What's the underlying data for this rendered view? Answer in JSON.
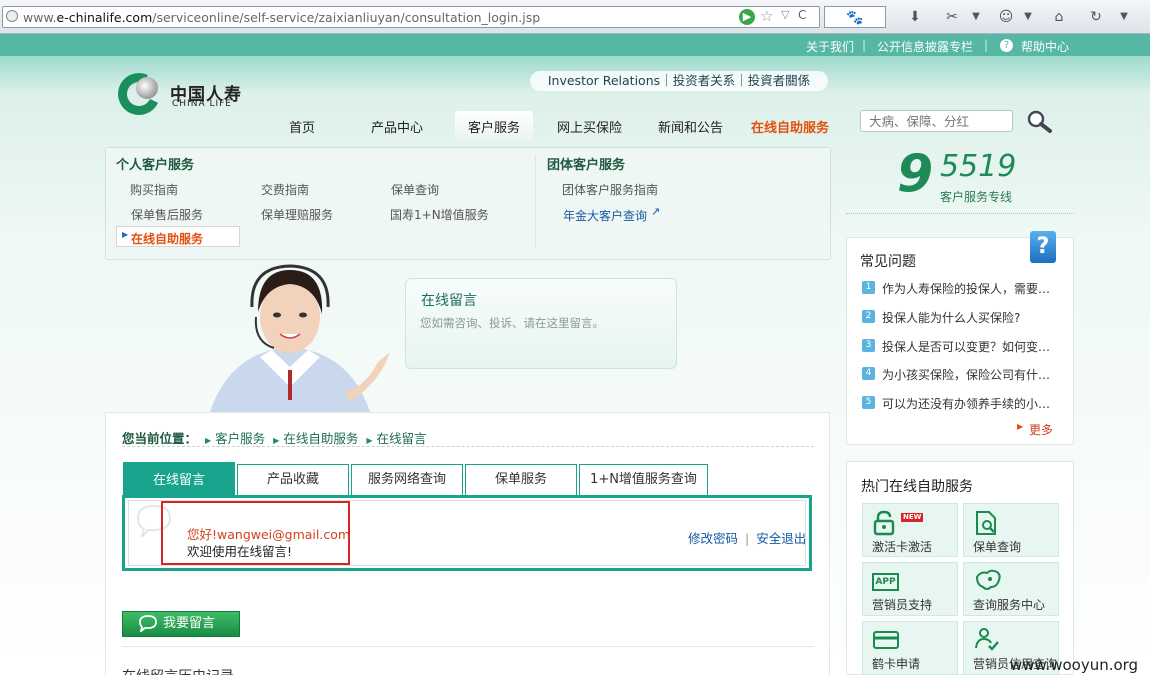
{
  "browser": {
    "url_prefix": "www.",
    "url_host": "e-chinalife.com",
    "url_path": "/serviceonline/self-service/zaixianliuyan/consultation_login.jsp"
  },
  "toplinks": [
    "关于我们",
    "公开信息披露专栏",
    "帮助中心"
  ],
  "logo": {
    "cn": "中国人寿",
    "en": "CHINA LIFE"
  },
  "investor": "Investor Relations｜投资者关系｜投資者關係",
  "nav": [
    "首页",
    "产品中心",
    "客户服务",
    "网上买保险",
    "新闻和公告",
    "在线自助服务"
  ],
  "search": {
    "placeholder": "大病、保障、分红"
  },
  "subnav": {
    "personal_title": "个人客户服务",
    "personal_items": [
      "购买指南",
      "交费指南",
      "保单查询",
      "保单售后服务",
      "保单理赔服务",
      "国寿1+N增值服务",
      "在线自助服务"
    ],
    "group_title": "团体客户服务",
    "group_items": [
      "团体客户服务指南",
      "年金大客户查询"
    ]
  },
  "hotline": {
    "number": "9",
    "rest": "5519",
    "label": "客户服务专线"
  },
  "banner": {
    "title": "在线留言",
    "subtitle": "您如需咨询、投诉、请在这里留言。"
  },
  "breadcrumb": {
    "label": "您当前位置：",
    "items": [
      "客户服务",
      "在线自助服务",
      "在线留言"
    ]
  },
  "tabs": [
    "在线留言",
    "产品收藏",
    "服务网络查询",
    "保单服务",
    "1+N增值服务查询"
  ],
  "greeting": {
    "line1": "您好!wangwei@gmail.com",
    "line2": "欢迎使用在线留言!"
  },
  "account": {
    "change_password": "修改密码",
    "logout": "安全退出"
  },
  "message_button": "我要留言",
  "cutoff_heading": "在线留言历史记录",
  "faq": {
    "title": "常见问题",
    "items": [
      "作为人寿保险的投保人，需要…",
      "投保人能为什么人买保险?",
      "投保人是否可以变更？如何变…",
      "为小孩买保险，保险公司有什…",
      "可以为还没有办领养手续的小…"
    ],
    "more": "更多"
  },
  "services": {
    "title": "热门在线自助服务",
    "items": [
      "激活卡激活",
      "保单查询",
      "营销员支持",
      "查询服务中心",
      "鹤卡申请",
      "营销员信用查询"
    ],
    "new_badge": "NEW",
    "app_label": "APP"
  },
  "watermark": "www.wooyun.org",
  "colors": {
    "brand_green": "#1a8f5b",
    "tab_teal": "#18a48d",
    "highlight_red": "#d8232a",
    "link_blue": "#1559a5",
    "accent_orange": "#d0421f"
  }
}
